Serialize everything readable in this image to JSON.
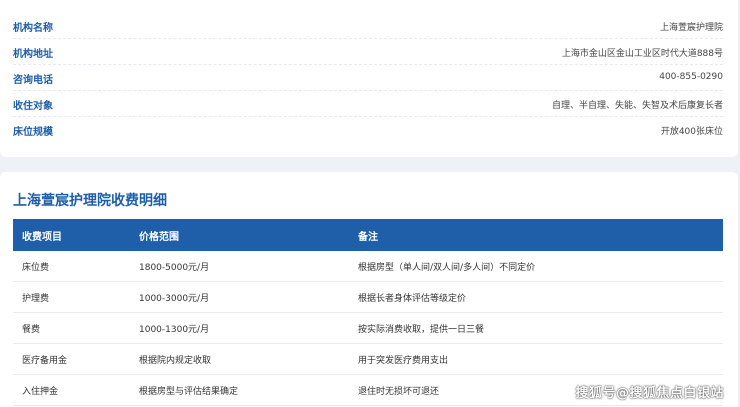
{
  "info": {
    "items": [
      {
        "label": "机构名称",
        "value": "上海萱宸护理院"
      },
      {
        "label": "机构地址",
        "value": "上海市金山区金山工业区时代大道888号"
      },
      {
        "label": "咨询电话",
        "value": "400-855-0290"
      },
      {
        "label": "收住对象",
        "value": "自理、半自理、失能、失智及术后康复长者"
      },
      {
        "label": "床位规模",
        "value": "开放400张床位"
      }
    ]
  },
  "fees": {
    "title": "上海萱宸护理院收费明细",
    "headers": [
      "收费项目",
      "价格范围",
      "备注"
    ],
    "rows": [
      [
        "床位费",
        "1800-5000元/月",
        "根据房型（单人间/双人间/多人间）不同定价"
      ],
      [
        "护理费",
        "1000-3000元/月",
        "根据长者身体评估等级定价"
      ],
      [
        "餐费",
        "1000-1300元/月",
        "按实际消费收取，提供一日三餐"
      ],
      [
        "医疗备用金",
        "根据院内规定收取",
        "用于突发医疗费用支出"
      ],
      [
        "入住押金",
        "根据房型与评估结果确定",
        "退住时无损坏可退还"
      ]
    ]
  },
  "watermark": "搜狐号@搜狐焦点白银站"
}
